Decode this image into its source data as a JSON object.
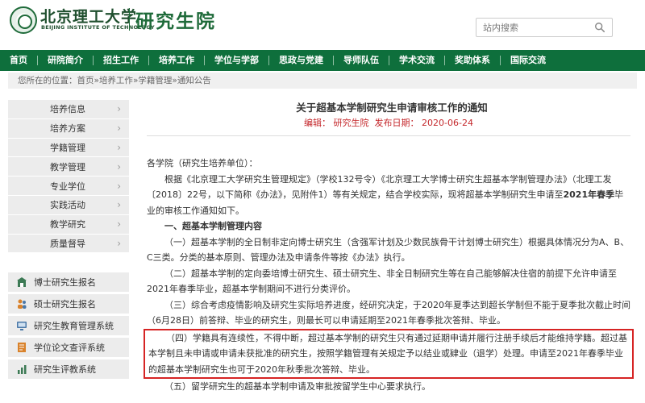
{
  "header": {
    "logo_cn": "北京理工大学",
    "logo_en": "BEIJING INSTITUTE OF TECHNOLOGY",
    "site_name": "研究生院",
    "search_placeholder": "站内搜索"
  },
  "nav": {
    "items": [
      "首页",
      "研院简介",
      "招生工作",
      "培养工作",
      "学位与学部",
      "思政与党建",
      "导师队伍",
      "学术交流",
      "奖助体系",
      "国际交流"
    ]
  },
  "breadcrumb": {
    "prefix": "您所在的位置：",
    "items": [
      "首页",
      "培养工作",
      "学籍管理",
      "通知公告"
    ],
    "separator": "»"
  },
  "sidebar": {
    "items": [
      "培养信息",
      "培养方案",
      "学籍管理",
      "教学管理",
      "专业学位",
      "实践活动",
      "教学研究",
      "质量督导"
    ],
    "chevron": "›"
  },
  "quicklinks": {
    "items": [
      {
        "label": "博士研究生报名",
        "icon": "building-icon"
      },
      {
        "label": "硕士研究生报名",
        "icon": "people-icon"
      },
      {
        "label": "研究生教育管理系统",
        "icon": "monitor-icon"
      },
      {
        "label": "学位论文查评系统",
        "icon": "document-icon"
      },
      {
        "label": "研究生评教系统",
        "icon": "chart-icon"
      }
    ]
  },
  "article": {
    "title": "关于超基本学制研究生申请审核工作的通知",
    "editor_label": "编辑：",
    "editor": "研究生院",
    "date_label": "发布日期：",
    "date": "2020-06-24",
    "salutation": "各学院（研究生培养单位）：",
    "intro": "根据《北京理工大学研究生管理规定》（学校132号令）《北京理工大学博士研究生超基本学制管理办法》（北理工发〔2018〕22号，以下简称《办法》，见附件1）等有关规定，结合学校实际，现将超基本学制研究生申请至",
    "intro_bold": "2021年春季",
    "intro_tail": "毕业的审核工作通知如下。",
    "section1": "一、超基本学制管理内容",
    "p1": "（一）超基本学制的全日制非定向博士研究生（含强军计划及少数民族骨干计划博士研究生）根据具体情况分为A、B、C三类。分类的基本原则、管理办法及申请条件等按《办法》执行。",
    "p2": "（二）超基本学制的定向委培博士研究生、硕士研究生、非全日制研究生等在自己能够解决住宿的前提下允许申请至2021年春季毕业，超基本学制期间不进行分类评价。",
    "p3": "（三）综合考虑疫情影响及研究生实际培养进度，经研究决定，于2020年夏季达到超长学制但不能于夏季批次截止时间（6月28日）前答辩、毕业的研究生，则最长可以申请延期至2021年春季批次答辩、毕业。",
    "p4": "（四）学籍具有连续性，不得中断，超过基本学制的研究生只有通过延期申请并履行注册手续后才能维持学籍。超过基本学制且未申请或申请未获批准的研究生，按照学籍管理有关规定予以结业或肄业（退学）处理。申请至2021年春季毕业的超基本学制研究生也可于2020年秋季批次答辩、毕业。",
    "p5": "（五）留学研究生的超基本学制申请及审批按留学生中心要求执行。"
  },
  "colors": {
    "brand_green": "#0e6f3c",
    "meta_red": "#c4272b",
    "highlight_red": "#d62424"
  }
}
